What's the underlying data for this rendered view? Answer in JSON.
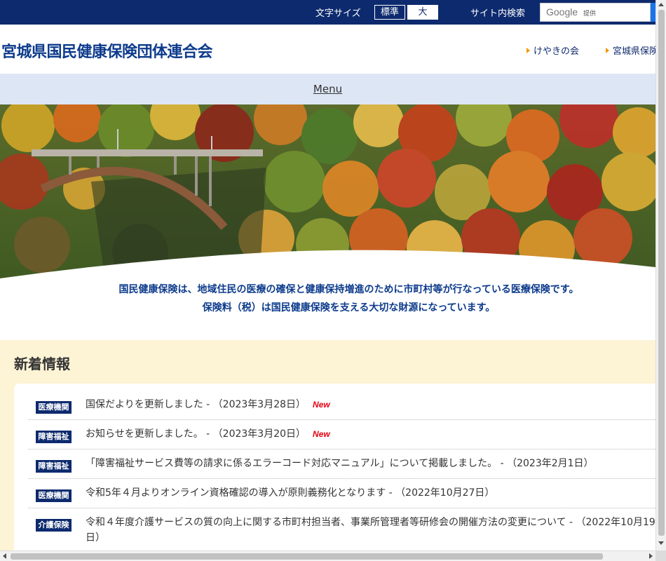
{
  "topbar": {
    "font_size_label": "文字サイズ",
    "font_size_standard": "標準",
    "font_size_large": "大",
    "site_search_label": "サイト内検索",
    "search_brand": "Google",
    "search_provided": "提供"
  },
  "header": {
    "site_title": "宮城県国民健康保険団体連合会",
    "links": [
      "けやきの会",
      "宮城県保険"
    ]
  },
  "menu": {
    "label": "Menu"
  },
  "hero": {
    "image": "autumn-bridge-photo"
  },
  "intro": {
    "line1": "国民健康保険は、地域住民の医療の確保と健康保持増進のために市町村等が行なっている医療保険です。",
    "line2": "保険料（税）は国民健康保険を支える大切な財源になっています。"
  },
  "news": {
    "heading": "新着情報",
    "items": [
      {
        "category": "医療機関",
        "text": "国保だよりを更新しました - （2023年3月28日）",
        "new_label": "New"
      },
      {
        "category": "障害福祉",
        "text": "お知らせを更新しました。 - （2023年3月20日）",
        "new_label": "New"
      },
      {
        "category": "障害福祉",
        "text": "「障害福祉サービス費等の請求に係るエラーコード対応マニュアル」について掲載しました。 - （2023年2月1日）",
        "new_label": ""
      },
      {
        "category": "医療機関",
        "text": "令和5年４月よりオンライン資格確認の導入が原則義務化となります - （2022年10月27日）",
        "new_label": ""
      },
      {
        "category": "介護保険",
        "text": "令和４年度介護サービスの質の向上に関する市町村担当者、事業所管理者等研修会の開催方法の変更について - （2022年10月19日）",
        "new_label": ""
      }
    ]
  },
  "colors": {
    "navy": "#0d2a6e",
    "title_blue": "#0d3b8c",
    "menu_bg": "#dde6f4",
    "news_bg": "#fdf4d6",
    "new_red": "#e60012",
    "arrow_orange": "#f39800"
  }
}
